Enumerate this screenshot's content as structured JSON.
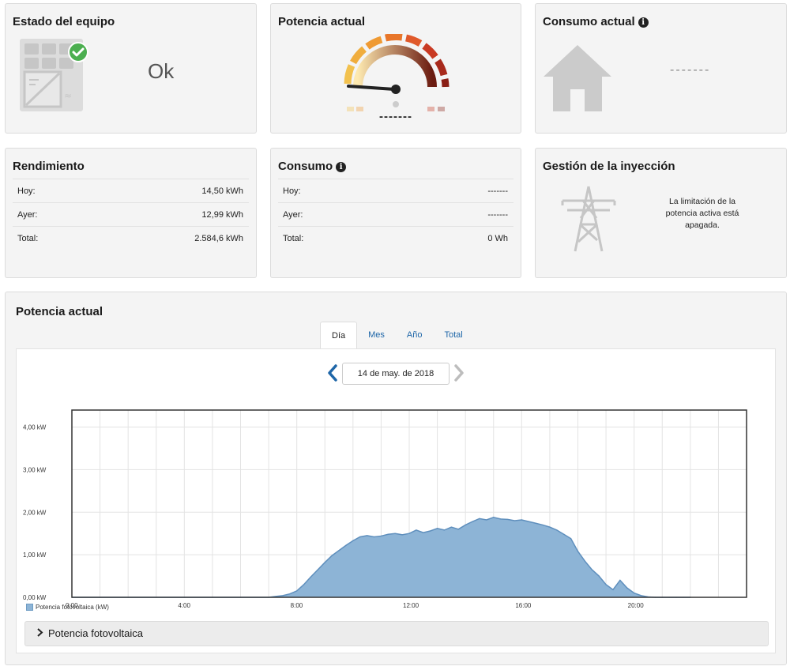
{
  "cards": {
    "status": {
      "title": "Estado del equipo",
      "value": "Ok"
    },
    "power": {
      "title": "Potencia actual",
      "value": "-------"
    },
    "consumption_now": {
      "title": "Consumo actual",
      "value": "-------"
    },
    "yield": {
      "title": "Rendimiento",
      "rows": [
        {
          "label": "Hoy:",
          "value": "14,50 kWh"
        },
        {
          "label": "Ayer:",
          "value": "12,99 kWh"
        },
        {
          "label": "Total:",
          "value": "2.584,6 kWh"
        }
      ]
    },
    "consumption": {
      "title": "Consumo",
      "rows": [
        {
          "label": "Hoy:",
          "value": "-------"
        },
        {
          "label": "Ayer:",
          "value": "-------"
        },
        {
          "label": "Total:",
          "value": "0 Wh"
        }
      ]
    },
    "feed_in": {
      "title": "Gestión de la inyección",
      "message": "La limitación de la potencia activa está apagada."
    }
  },
  "panel": {
    "title": "Potencia actual",
    "tabs": [
      {
        "label": "Día",
        "active": true
      },
      {
        "label": "Mes",
        "active": false
      },
      {
        "label": "Año",
        "active": false
      },
      {
        "label": "Total",
        "active": false
      }
    ],
    "date": "14 de may. de 2018",
    "accordion_label": "Potencia fotovoltaica"
  },
  "colors": {
    "accent_blue": "#1e66a8",
    "area_fill": "#8db4d6",
    "area_line": "#5f8fbd",
    "status_ok": "#4caf50"
  },
  "icons": {
    "status": "solar-panel-icon",
    "status_badge": "check-icon",
    "gauge": "gauge-icon",
    "consumption": "house-icon",
    "feed_in": "power-tower-icon",
    "info": "info-icon",
    "prev": "chevron-left-icon",
    "next": "chevron-right-icon",
    "accordion": "chevron-right-icon"
  },
  "chart_data": {
    "type": "area",
    "series": [
      {
        "name": "Potencia fotovoltaica (kW)",
        "x": [
          0,
          1,
          2,
          3,
          4,
          5,
          6,
          7,
          7.25,
          7.5,
          7.75,
          8,
          8.25,
          8.5,
          8.75,
          9,
          9.25,
          9.5,
          9.75,
          10,
          10.25,
          10.5,
          10.75,
          11,
          11.25,
          11.5,
          11.75,
          12,
          12.25,
          12.5,
          12.75,
          13,
          13.25,
          13.5,
          13.75,
          14,
          14.25,
          14.5,
          14.75,
          15,
          15.25,
          15.5,
          15.75,
          16,
          16.25,
          16.5,
          16.75,
          17,
          17.25,
          17.5,
          17.75,
          18,
          18.25,
          18.5,
          18.75,
          19,
          19.25,
          19.5,
          19.75,
          20,
          20.25,
          20.5,
          20.75,
          21,
          21.25,
          21.5,
          21.75,
          22
        ],
        "values": [
          0,
          0,
          0,
          0,
          0,
          0,
          0,
          0,
          0.02,
          0.04,
          0.08,
          0.15,
          0.3,
          0.48,
          0.65,
          0.82,
          0.98,
          1.1,
          1.22,
          1.33,
          1.42,
          1.45,
          1.42,
          1.44,
          1.48,
          1.5,
          1.47,
          1.5,
          1.58,
          1.52,
          1.56,
          1.62,
          1.58,
          1.65,
          1.6,
          1.7,
          1.78,
          1.85,
          1.82,
          1.88,
          1.84,
          1.83,
          1.8,
          1.82,
          1.78,
          1.74,
          1.7,
          1.65,
          1.58,
          1.48,
          1.38,
          1.08,
          0.85,
          0.65,
          0.5,
          0.3,
          0.18,
          0.4,
          0.22,
          0.1,
          0.04,
          0.01,
          0,
          0,
          0,
          0,
          0,
          0
        ]
      }
    ],
    "xlim": [
      0,
      24
    ],
    "ylim": [
      0,
      4.4
    ],
    "x_ticks": [
      {
        "value": 0,
        "label": "0:00"
      },
      {
        "value": 4,
        "label": "4:00"
      },
      {
        "value": 8,
        "label": "8:00"
      },
      {
        "value": 12,
        "label": "12:00"
      },
      {
        "value": 16,
        "label": "16:00"
      },
      {
        "value": 20,
        "label": "20:00"
      }
    ],
    "y_ticks": [
      {
        "value": 0,
        "label": "0,00 kW"
      },
      {
        "value": 1,
        "label": "1,00 kW"
      },
      {
        "value": 2,
        "label": "2,00 kW"
      },
      {
        "value": 3,
        "label": "3,00 kW"
      },
      {
        "value": 4,
        "label": "4,00 kW"
      }
    ],
    "grid": true,
    "legend_position": "bottom-left",
    "legend_label": "Potencia fotovoltaica (kW)"
  }
}
